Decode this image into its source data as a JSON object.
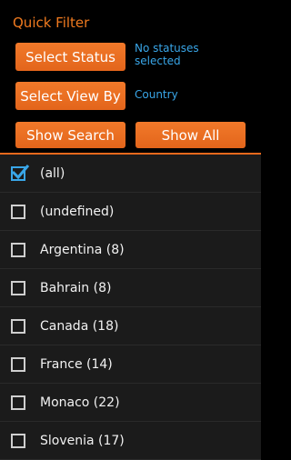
{
  "header": {
    "title": "Quick Filter",
    "select_status_label": "Select Status",
    "status_value": "No statuses selected",
    "select_viewby_label": "Select View By",
    "viewby_value": "Country",
    "show_search_label": "Show Search",
    "show_all_label": "Show All"
  },
  "list": {
    "items": [
      {
        "label": "(all)",
        "checked": true
      },
      {
        "label": "(undefined)",
        "checked": false
      },
      {
        "label": "Argentina (8)",
        "checked": false
      },
      {
        "label": "Bahrain (8)",
        "checked": false
      },
      {
        "label": "Canada (18)",
        "checked": false
      },
      {
        "label": "France (14)",
        "checked": false
      },
      {
        "label": "Monaco (22)",
        "checked": false
      },
      {
        "label": "Slovenia (17)",
        "checked": false
      }
    ]
  },
  "colors": {
    "accent_orange": "#f07a1f",
    "accent_blue": "#39a6e8",
    "list_background": "#1b1b1b"
  },
  "icons": {
    "checkbox_checked": "check-icon"
  }
}
